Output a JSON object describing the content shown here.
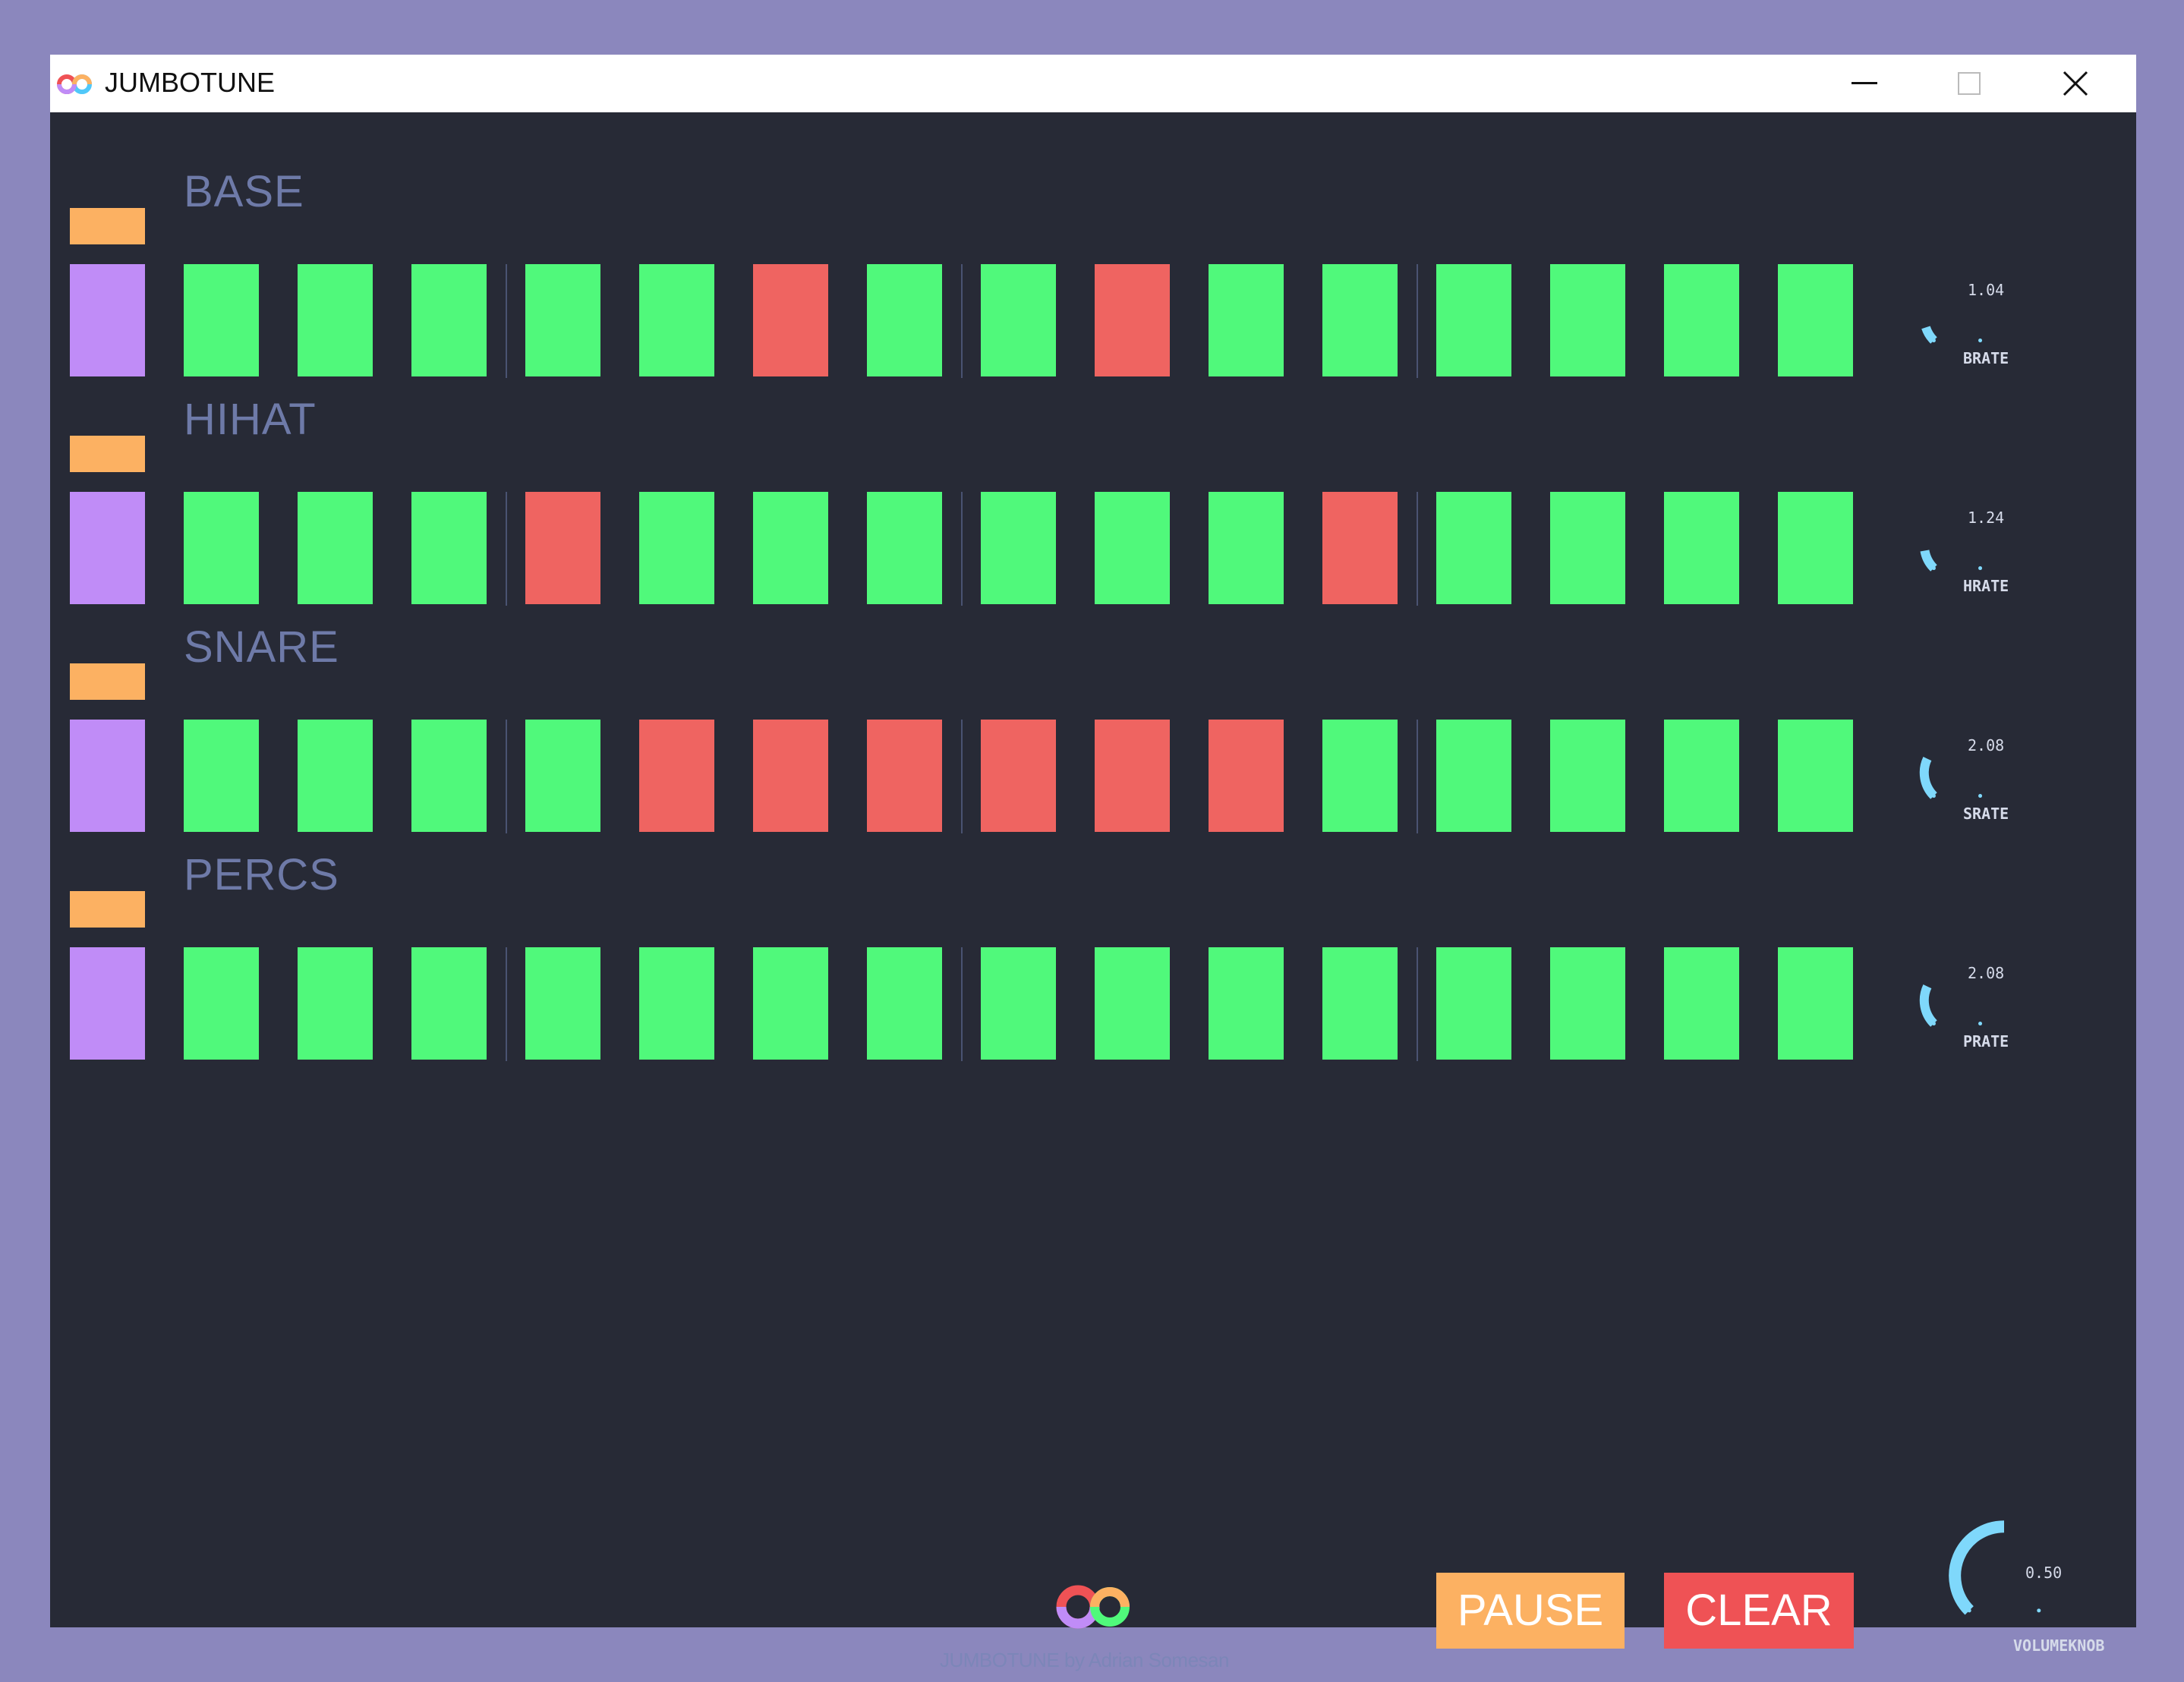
{
  "window": {
    "title": "JUMBOTUNE",
    "app_icon": "jumbotune-logo-icon",
    "controls": [
      "minimize-icon",
      "maximize-icon",
      "close-icon"
    ]
  },
  "colors": {
    "background": "#272a36",
    "step_off": "#50f97b",
    "step_on": "#ef6461",
    "mute": "#fcb162",
    "solo": "#c08cf7",
    "label": "#6e7aa8",
    "knob": "#7fd8fb",
    "pause": "#fcb162",
    "clear": "#ef5255"
  },
  "tracks": [
    {
      "name": "BASE",
      "steps": [
        0,
        0,
        0,
        0,
        0,
        1,
        0,
        0,
        1,
        0,
        0,
        0,
        0,
        0,
        0
      ],
      "knob": {
        "value": "1.04",
        "label": "BRATE",
        "level": 0.1
      }
    },
    {
      "name": "HIHAT",
      "steps": [
        0,
        0,
        0,
        1,
        0,
        0,
        0,
        0,
        0,
        0,
        1,
        0,
        0,
        0,
        0
      ],
      "knob": {
        "value": "1.24",
        "label": "HRATE",
        "level": 0.13
      }
    },
    {
      "name": "SNARE",
      "steps": [
        0,
        0,
        0,
        0,
        1,
        1,
        1,
        1,
        1,
        1,
        0,
        0,
        0,
        0,
        0
      ],
      "knob": {
        "value": "2.08",
        "label": "SRATE",
        "level": 0.26
      }
    },
    {
      "name": "PERCS",
      "steps": [
        0,
        0,
        0,
        0,
        0,
        0,
        0,
        0,
        0,
        0,
        0,
        0,
        0,
        0,
        0
      ],
      "knob": {
        "value": "2.08",
        "label": "PRATE",
        "level": 0.26
      }
    }
  ],
  "volume": {
    "value": "0.50",
    "label": "VOLUMEKNOB",
    "level": 0.5
  },
  "buttons": {
    "pause": "PAUSE",
    "clear": "CLEAR"
  },
  "footer": {
    "logo": "jumbotune-logo-icon",
    "credit": "JUMBOTUNE by Adrian Somesan"
  }
}
